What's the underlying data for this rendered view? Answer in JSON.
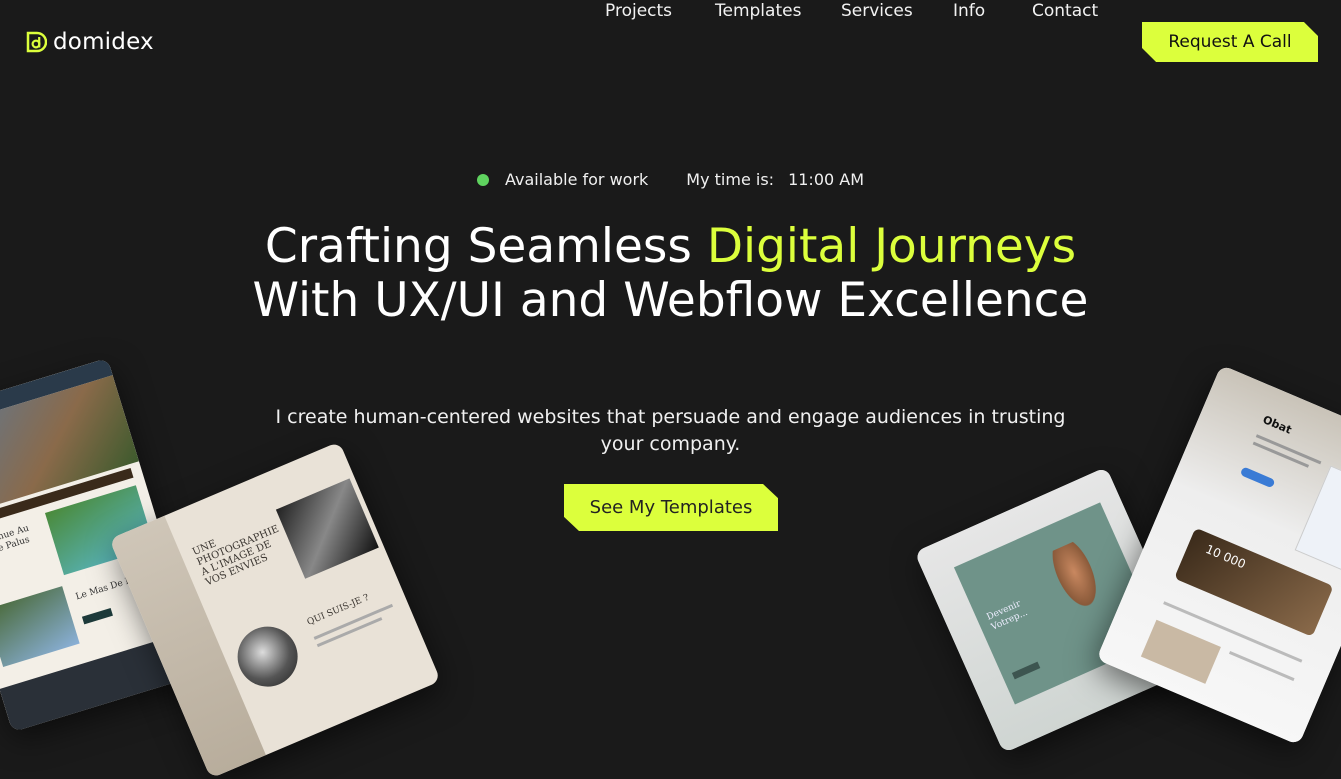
{
  "header": {
    "logo_text": "domidex",
    "nav": [
      "Projects",
      "Templates",
      "Services",
      "Info",
      "Contact"
    ],
    "cta_label": "Request A Call"
  },
  "status": {
    "available": "Available for work",
    "time_label": "My time is:",
    "time_value": "11:00 AM"
  },
  "hero": {
    "title_part1": "Crafting Seamless ",
    "title_accent": "Digital Journeys",
    "title_part2": "With UX/UI and Webflow Excellence",
    "subtitle": "I create human-centered websites that persuade and engage audiences in trusting your company.",
    "button_label": "See My Templates"
  },
  "mockups": {
    "card_a_heading": "Bienvenue Au Mas de Palus",
    "card_a_subheading": "Le Mas De Palus",
    "card_b_heading": "UNE PHOTOGRAPHIE A L'IMAGE DE VOS ENVIES",
    "card_b_subheading": "QUI SUIS-JE ?",
    "card_c_heading": "Devenir Votrep...",
    "card_d_logo": "Obat",
    "card_d_number": "10 000"
  },
  "colors": {
    "background": "#1a1a1a",
    "accent": "#dcff3c",
    "status_dot": "#5fd35f"
  }
}
